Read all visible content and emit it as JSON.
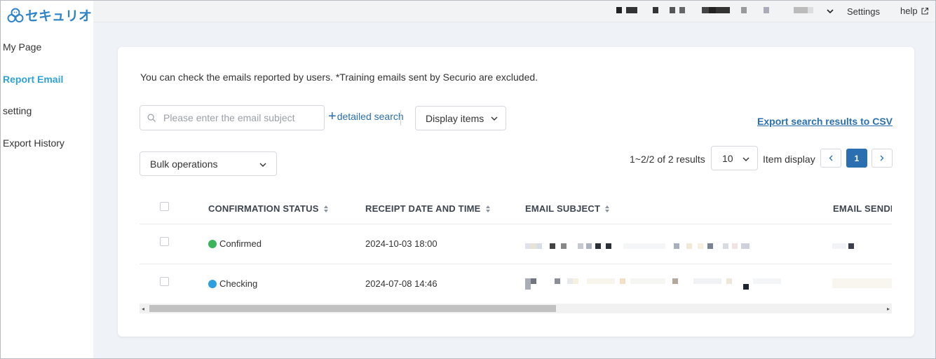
{
  "sidebar": {
    "logo_text": "セキュリオ",
    "items": [
      {
        "label": "My Page"
      },
      {
        "label": "Report Email"
      },
      {
        "label": "setting"
      },
      {
        "label": "Export History"
      }
    ]
  },
  "topbar": {
    "settings_label": "Settings",
    "help_label": "help"
  },
  "page": {
    "description": "You can check the emails reported by users. *Training emails sent by Securio are excluded.",
    "search_placeholder": "Please enter the email subject",
    "detailed_search_label": "detailed search",
    "display_items_label": "Display items",
    "export_csv_label": "Export search results to CSV",
    "bulk_operations_label": "Bulk operations",
    "results_text": "1~2/2 of 2 results",
    "per_page_value": "10",
    "item_display_label": "Item display",
    "current_page": "1"
  },
  "table": {
    "columns": [
      {
        "label": "CONFIRMATION STATUS"
      },
      {
        "label": "RECEIPT DATE AND TIME"
      },
      {
        "label": "EMAIL SUBJECT"
      },
      {
        "label": "EMAIL SENDE"
      }
    ],
    "rows": [
      {
        "status": "Confirmed",
        "status_color": "#3bb55b",
        "received": "2024-10-03 18:00"
      },
      {
        "status": "Checking",
        "status_color": "#2d9fe0",
        "received": "2024-07-08 14:46"
      }
    ]
  },
  "colors": {
    "accent_blue": "#2a6fb0",
    "active_nav": "#2fa3d6",
    "logo_blue": "#2f83c7"
  }
}
